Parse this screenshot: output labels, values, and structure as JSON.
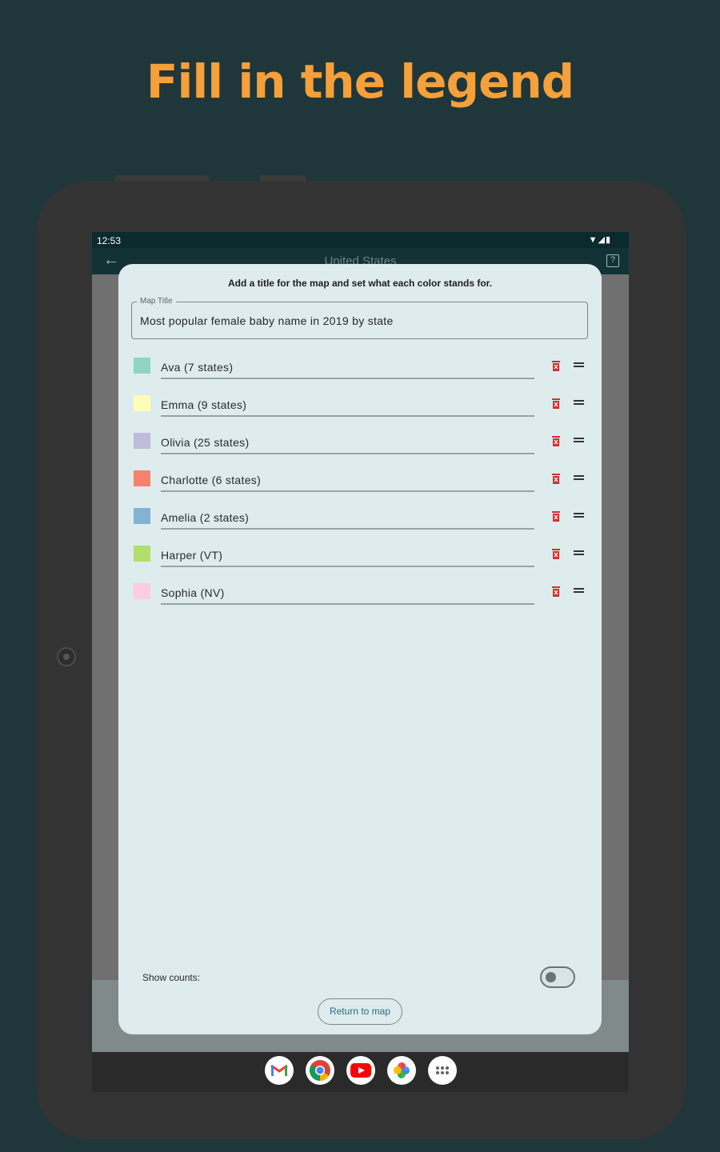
{
  "headline": "Fill in the legend",
  "status": {
    "time": "12:53",
    "icons": "▼◢▮"
  },
  "appbar": {
    "back_icon": "arrow-left-icon",
    "title": "United States",
    "help_icon": "help-icon"
  },
  "dialog": {
    "instruction": "Add a title for the map and set what each color stands for.",
    "map_title": {
      "label": "Map Title",
      "value": "Most popular female baby name in 2019 by state"
    },
    "legend": [
      {
        "label": "Ava (7 states)",
        "color": "#8fd4c4"
      },
      {
        "label": "Emma (9 states)",
        "color": "#fdfdb8"
      },
      {
        "label": "Olivia (25 states)",
        "color": "#bfbbdb"
      },
      {
        "label": "Charlotte (6 states)",
        "color": "#f7806f"
      },
      {
        "label": "Amelia (2 states)",
        "color": "#84b1d6"
      },
      {
        "label": "Harper (VT)",
        "color": "#b2df6b"
      },
      {
        "label": "Sophia (NV)",
        "color": "#fbcde5"
      }
    ],
    "show_counts_label": "Show counts:",
    "show_counts": false,
    "return_button": "Return to map"
  },
  "dock": [
    "gmail-icon",
    "chrome-icon",
    "youtube-icon",
    "photos-icon",
    "app-drawer-icon"
  ]
}
